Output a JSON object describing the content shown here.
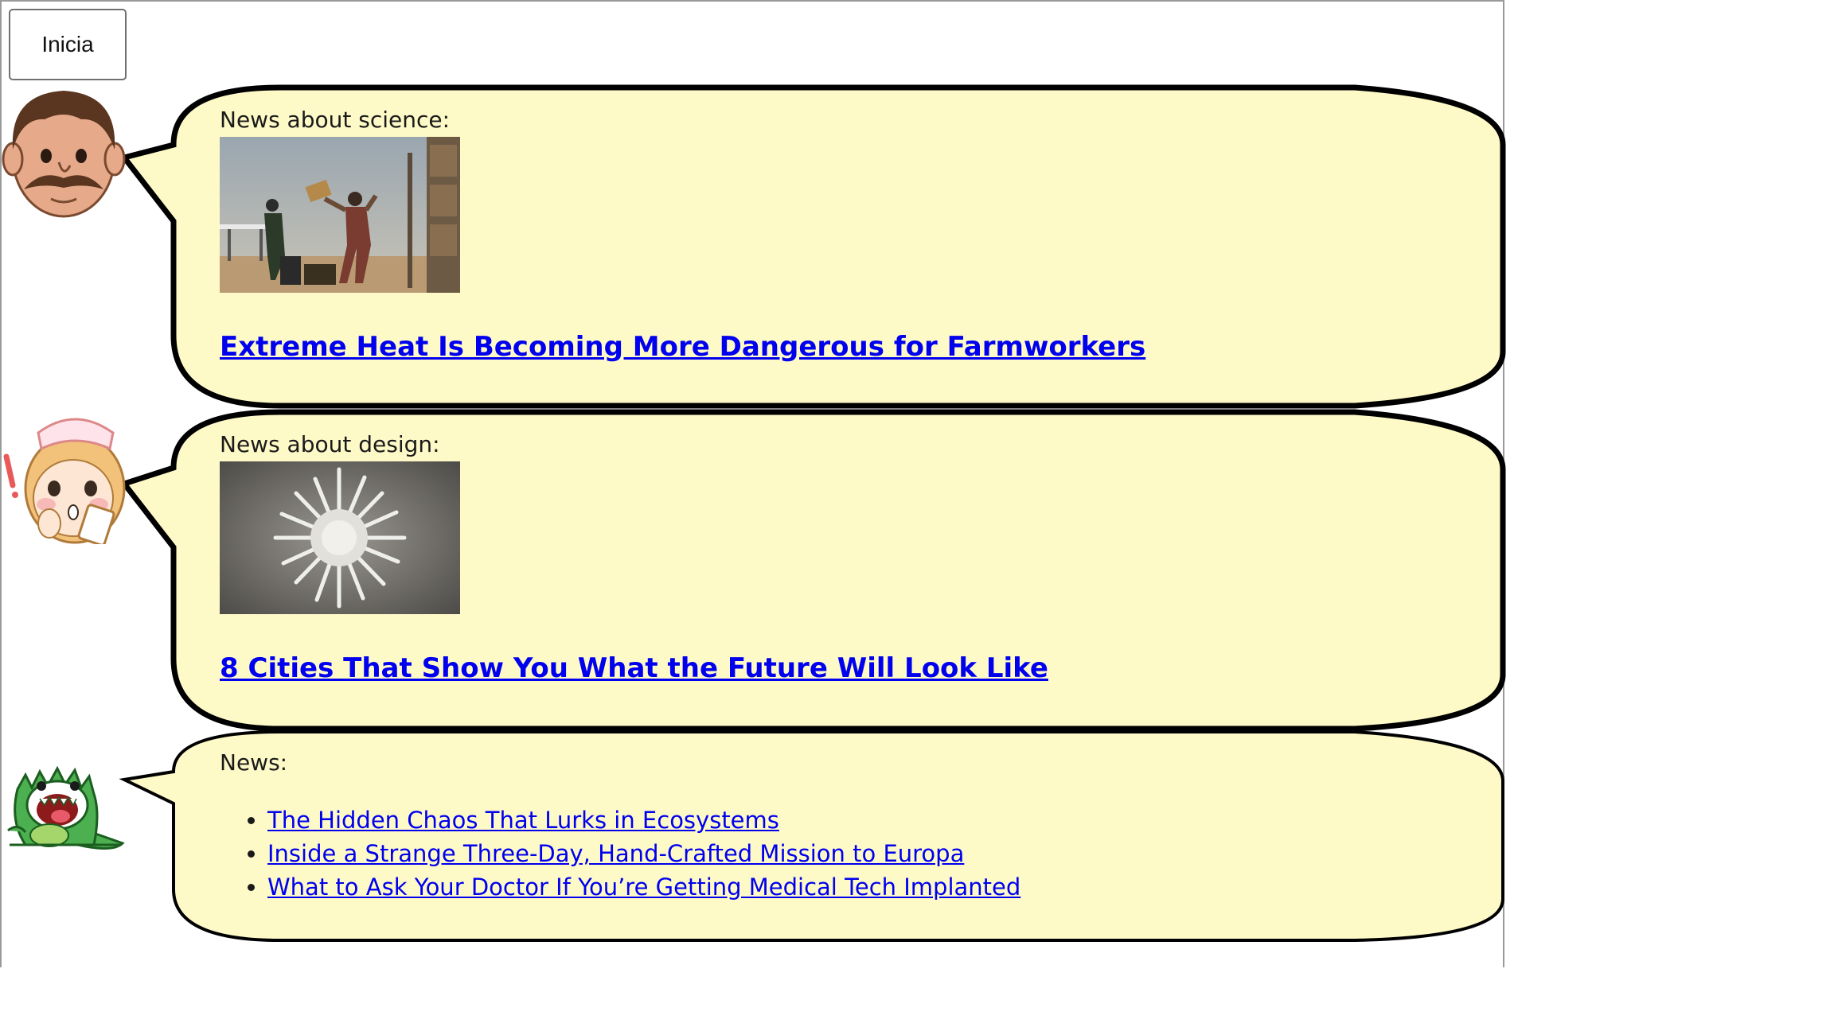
{
  "start_button": {
    "label": "Inicia"
  },
  "colors": {
    "bubble_fill": "#fefac8",
    "bubble_stroke": "#000000",
    "link": "#0000ee"
  },
  "bubbles": [
    {
      "avatar": "mustache-man-icon",
      "heading": "News about science:",
      "image": "farmworkers-photo",
      "link_text": "Extreme Heat Is Becoming More Dangerous for Farmworkers"
    },
    {
      "avatar": "nurse-girl-icon",
      "heading": "News about design:",
      "image": "future-city-sculpture-photo",
      "link_text": "8 Cities That Show You What the Future Will Look Like"
    },
    {
      "avatar": "green-monster-icon",
      "heading": "News:",
      "items": [
        "The Hidden Chaos That Lurks in Ecosystems",
        "Inside a Strange Three-Day, Hand-Crafted Mission to Europa",
        "What to Ask Your Doctor If You’re Getting Medical Tech Implanted"
      ]
    }
  ]
}
